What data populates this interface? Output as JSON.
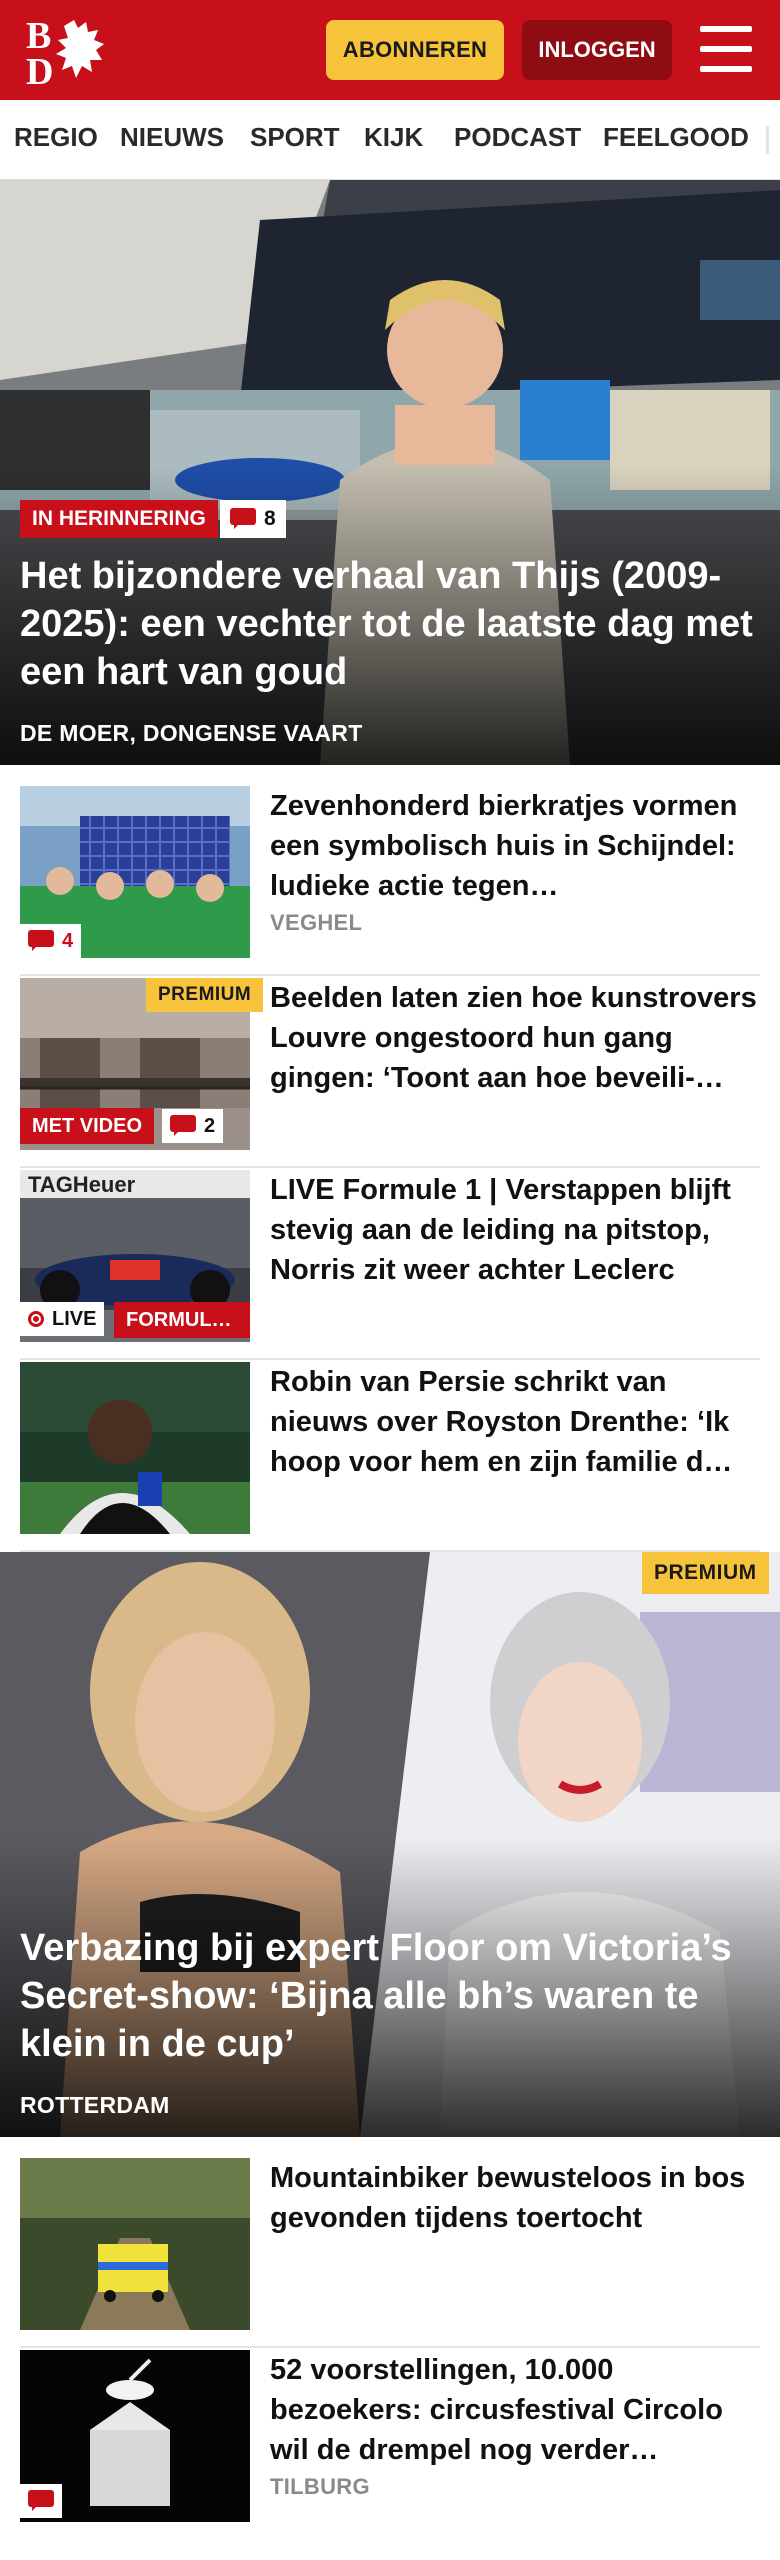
{
  "header": {
    "subscribe_label": "ABONNEREN",
    "login_label": "INLOGGEN",
    "logo_letters": "BD",
    "brand_red": "#c8101a",
    "accent_yellow": "#f6c33a"
  },
  "nav": {
    "items": [
      "REGIO",
      "NIEUWS",
      "SPORT",
      "KIJK",
      "PODCAST",
      "FEELGOOD"
    ]
  },
  "hero": {
    "tag": "IN HERINNERING",
    "comments": "8",
    "title": "Het bijzondere verhaal van Thijs (2009-2025): een vechter tot de laatste dag met een hart van goud",
    "location": "DE MOER, DONGENSE VAART"
  },
  "articles": [
    {
      "title": "Zevenhonderd bierkratjes vormen een symbolisch huis in Schijndel: ludieke actie tegen…",
      "location": "VEGHEL",
      "comments": "4"
    },
    {
      "title": "Beelden laten zien hoe kunstro­vers Louvre ongestoord hun gang gingen: ‘Toont aan hoe beveili-…",
      "premium": "PREMIUM",
      "video_tag": "MET VIDEO",
      "comments": "2"
    },
    {
      "title": "LIVE Formule 1 | Verstappen blijft stevig aan de leiding na pitstop, Norris zit weer achter Leclerc",
      "live_label": "LIVE",
      "category_tag": "FORMUL…"
    },
    {
      "title": "Robin van Persie schrikt van nieuws over Royston Drenthe: ‘Ik hoop voor hem en zijn familie d…"
    }
  ],
  "hero2": {
    "premium": "PREMIUM",
    "title": "Verbazing bij expert Floor om Victoria’s Secret-show: ‘Bijna alle bh’s waren te klein in de cup’",
    "location": "ROTTERDAM"
  },
  "articles2": [
    {
      "title": "Mountainbiker bewusteloos in bos gevonden tijdens toertocht"
    },
    {
      "title": "52 voorstellingen, 10.000 bezoekers: circusfestival Circolo wil de drempel nog verder…",
      "location": "TILBURG"
    }
  ]
}
